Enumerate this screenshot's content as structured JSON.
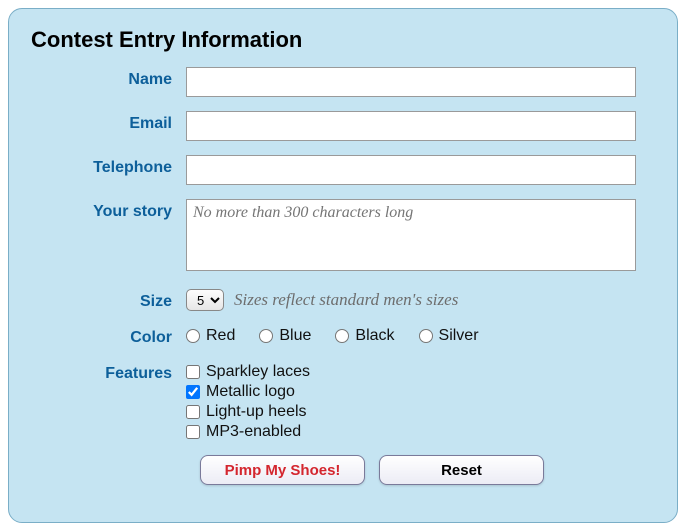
{
  "title": "Contest Entry Information",
  "labels": {
    "name": "Name",
    "email": "Email",
    "telephone": "Telephone",
    "story": "Your story",
    "size": "Size",
    "color": "Color",
    "features": "Features"
  },
  "fields": {
    "name": "",
    "email": "",
    "telephone": "",
    "story": "",
    "story_placeholder": "No more than 300 characters long",
    "size_selected": "5",
    "size_hint": "Sizes reflect standard men's sizes"
  },
  "colors": [
    "Red",
    "Blue",
    "Black",
    "Silver"
  ],
  "features": [
    {
      "label": "Sparkley laces",
      "checked": false
    },
    {
      "label": "Metallic logo",
      "checked": true
    },
    {
      "label": "Light-up heels",
      "checked": false
    },
    {
      "label": "MP3-enabled",
      "checked": false
    }
  ],
  "buttons": {
    "submit": "Pimp My Shoes!",
    "reset": "Reset"
  }
}
